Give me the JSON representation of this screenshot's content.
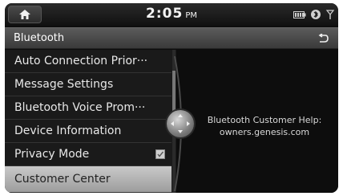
{
  "status": {
    "time": "2:05",
    "ampm": "PM"
  },
  "header": {
    "title": "Bluetooth"
  },
  "menu": {
    "items": [
      {
        "label": "Auto Connection Prior···"
      },
      {
        "label": "Message Settings"
      },
      {
        "label": "Bluetooth Voice Prom···"
      },
      {
        "label": "Device Information"
      },
      {
        "label": "Privacy Mode",
        "checked": true
      },
      {
        "label": "Customer Center",
        "selected": true
      }
    ]
  },
  "help": {
    "line1": "Bluetooth Customer Help:",
    "line2": "owners.genesis.com"
  },
  "icons": {
    "home": "home-icon",
    "back": "back-arrow-icon",
    "battery": "battery-icon",
    "bluetooth_phone": "bluetooth-phone-icon",
    "signal": "signal-icon",
    "jog": "jog-dial-icon"
  }
}
